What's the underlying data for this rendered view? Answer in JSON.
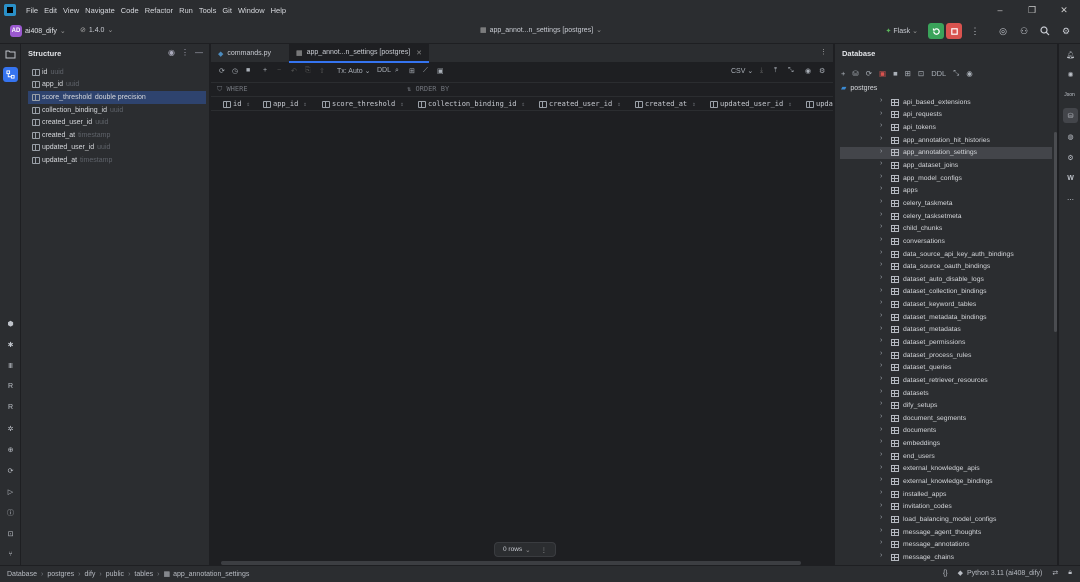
{
  "menu": [
    "File",
    "Edit",
    "View",
    "Navigate",
    "Code",
    "Refactor",
    "Run",
    "Tools",
    "Git",
    "Window",
    "Help"
  ],
  "project": {
    "avatar": "AD",
    "name": "ai408_dify",
    "version": "1.4.0"
  },
  "window_title": "app_annot...n_settings [postgres]",
  "run_config": "Flask",
  "accent_colors": {
    "run": "#3aa35a",
    "stop": "#d9534f",
    "selection": "#2e436e",
    "brand": "#2a90c8"
  },
  "structure": {
    "title": "Structure",
    "items": [
      {
        "name": "id",
        "type": "uuid"
      },
      {
        "name": "app_id",
        "type": "uuid"
      },
      {
        "name": "score_threshold",
        "type": "double precision"
      },
      {
        "name": "collection_binding_id",
        "type": "uuid"
      },
      {
        "name": "created_user_id",
        "type": "uuid"
      },
      {
        "name": "created_at",
        "type": "timestamp"
      },
      {
        "name": "updated_user_id",
        "type": "uuid"
      },
      {
        "name": "updated_at",
        "type": "timestamp"
      }
    ]
  },
  "tabs": [
    {
      "label": "commands.py"
    },
    {
      "label": "app_annot...n_settings [postgres]"
    }
  ],
  "grid_toolbar": {
    "tx": "Tx: Auto",
    "ddl": "DDL",
    "export": "CSV"
  },
  "filter": {
    "where": "WHERE",
    "order_by": "ORDER BY"
  },
  "columns": [
    "id",
    "app_id",
    "score_threshold",
    "collection_binding_id",
    "created_user_id",
    "created_at",
    "updated_user_id",
    "upda"
  ],
  "rows_label": "0 rows",
  "database": {
    "title": "Database",
    "ddl": "DDL",
    "root": "postgres",
    "tables": [
      "api_based_extensions",
      "api_requests",
      "api_tokens",
      "app_annotation_hit_histories",
      "app_annotation_settings",
      "app_dataset_joins",
      "app_model_configs",
      "apps",
      "celery_taskmeta",
      "celery_tasksetmeta",
      "child_chunks",
      "conversations",
      "data_source_api_key_auth_bindings",
      "data_source_oauth_bindings",
      "dataset_auto_disable_logs",
      "dataset_collection_bindings",
      "dataset_keyword_tables",
      "dataset_metadata_bindings",
      "dataset_metadatas",
      "dataset_permissions",
      "dataset_process_rules",
      "dataset_queries",
      "dataset_retriever_resources",
      "datasets",
      "dify_setups",
      "document_segments",
      "documents",
      "embeddings",
      "end_users",
      "external_knowledge_apis",
      "external_knowledge_bindings",
      "installed_apps",
      "invitation_codes",
      "load_balancing_model_configs",
      "message_agent_thoughts",
      "message_annotations",
      "message_chains"
    ],
    "selected": "app_annotation_settings"
  },
  "right_strip": {
    "json": "Json",
    "w": "W"
  },
  "breadcrumb": [
    "Database",
    "postgres",
    "dify",
    "public",
    "tables",
    "app_annotation_settings"
  ],
  "status": {
    "braces": "{}",
    "interpreter": "Python 3.11 (ai408_dify)"
  }
}
